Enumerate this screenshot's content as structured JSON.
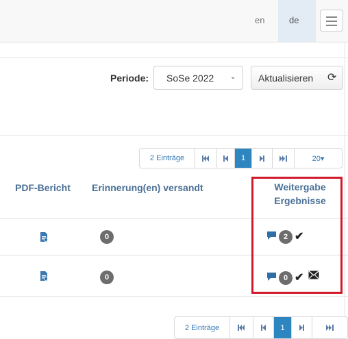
{
  "nav": {
    "lang_en": "en",
    "lang_de": "de",
    "menu_icon": "hamburger-icon"
  },
  "filter": {
    "period_label": "Periode:",
    "period_value": "SoSe 2022",
    "refresh_label": "Aktualisieren",
    "refresh_icon": "refresh-icon"
  },
  "pagination_top": {
    "count": "2 Einträge",
    "first": "⏮",
    "prev": "◀",
    "current": "1",
    "next": "▶",
    "last": "⏭",
    "page_size": "20▾"
  },
  "table": {
    "col_pdf": "PDF-Bericht",
    "col_reminders": "Erinnerung(en) versandt",
    "col_share_line1": "Weitergabe",
    "col_share_line2": "Ergebnisse",
    "rows": [
      {
        "reminders": "0",
        "shared_count": "2",
        "has_mail": false
      },
      {
        "reminders": "0",
        "shared_count": "0",
        "has_mail": true
      }
    ]
  },
  "pagination_bottom": {
    "count": "2 Einträge",
    "first": "⏮",
    "prev": "◀",
    "current": "1",
    "next": "▶",
    "last": "⏭"
  },
  "colors": {
    "highlight_box": "#d0192a",
    "active_page": "#2e86c1",
    "header_text": "#4a6f96"
  }
}
